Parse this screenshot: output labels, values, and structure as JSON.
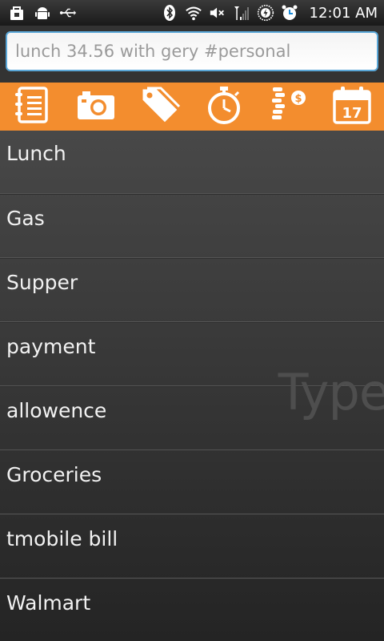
{
  "status_bar": {
    "time": "12:01 AM",
    "icons": [
      "bag-icon",
      "android-icon",
      "usb-icon",
      "bluetooth-icon",
      "wifi-icon",
      "mute-icon",
      "signal-icon",
      "battery-charging-icon",
      "alarm-icon"
    ]
  },
  "entry": {
    "placeholder": "lunch 34.56 with gery #personal"
  },
  "toolbar": {
    "buttons": [
      "notebook-icon",
      "camera-icon",
      "tag-icon",
      "stopwatch-icon",
      "coins-icon",
      "calendar-icon"
    ],
    "calendar_day": "17",
    "coin_symbol": "$"
  },
  "list": {
    "items": [
      {
        "label": "Lunch"
      },
      {
        "label": "Gas"
      },
      {
        "label": "Supper"
      },
      {
        "label": "payment"
      },
      {
        "label": "allowence"
      },
      {
        "label": "Groceries"
      },
      {
        "label": "tmobile bill"
      },
      {
        "label": "Walmart"
      }
    ],
    "watermark": "Type"
  },
  "colors": {
    "toolbar_orange": "#f38d2e",
    "input_border": "#5aa7d8",
    "list_text": "#f2f2f2"
  }
}
